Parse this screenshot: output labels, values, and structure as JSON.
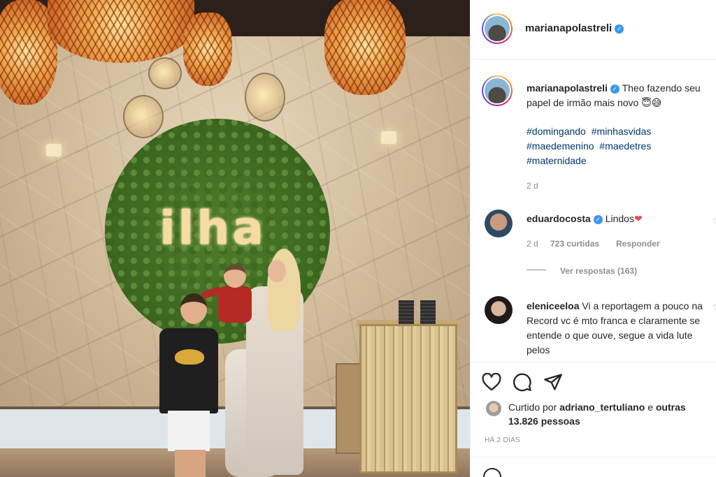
{
  "photo": {
    "sign_text": "ilha"
  },
  "header": {
    "username": "marianapolastreli",
    "verified_mark": "✓"
  },
  "caption": {
    "username": "marianapolastreli",
    "verified_mark": "✓",
    "text": "Theo fazendo seu papel de irmão mais novo 😇😅",
    "hashtags": [
      "#domingando",
      "#minhasvidas",
      "#maedemenino",
      "#maedetres",
      "#maternidade"
    ],
    "time": "2 d"
  },
  "comments": [
    {
      "username": "eduardocosta",
      "verified_mark": "✓",
      "text": "Lindos",
      "emoji": "❤",
      "time": "2 d",
      "likes": "723 curtidas",
      "reply_label": "Responder",
      "view_replies": "Ver respostas (163)"
    },
    {
      "username": "eleniceeloa",
      "text": "Vi a reportagem a pouco na Record vc é mto franca e claramente se entende o que ouve, segue a vida lute pelos"
    }
  ],
  "actions": {
    "like_icon": "heart-outline-icon",
    "comment_icon": "comment-bubble-icon",
    "share_icon": "paper-plane-icon"
  },
  "likes": {
    "prefix": "Curtido por",
    "user": "adriano_tertuliano",
    "suffix": "e",
    "others": "outras 13.826 pessoas"
  },
  "timestamp": "HÁ 2 DIAS",
  "colors": {
    "link": "#00376b",
    "verified": "#3897f0",
    "muted": "#8e8e8e",
    "heart": "#ed4956"
  }
}
